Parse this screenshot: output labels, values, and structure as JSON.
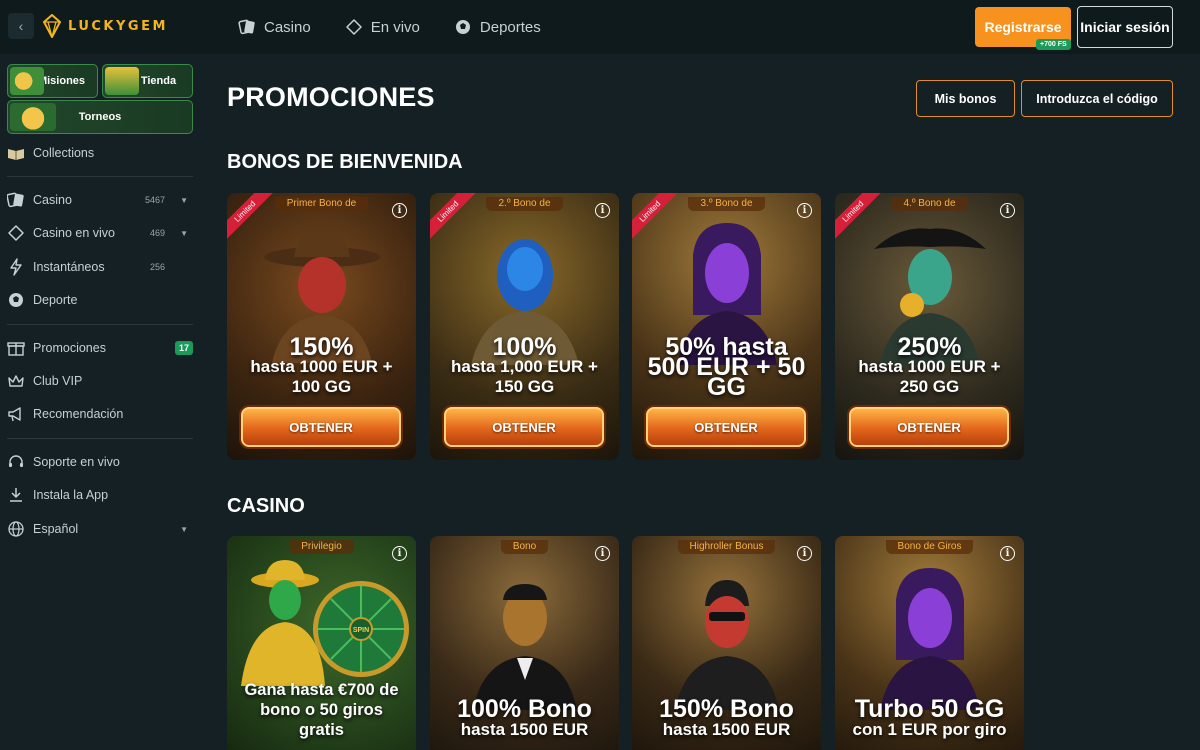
{
  "header": {
    "logo_text": "LUCKYGEM",
    "nav": [
      {
        "label": "Casino",
        "icon": "cards-icon"
      },
      {
        "label": "En vivo",
        "icon": "live-diamond-icon"
      },
      {
        "label": "Deportes",
        "icon": "soccer-ball-icon"
      }
    ],
    "register_label": "Registrarse",
    "register_badge": "+700 FS",
    "login_label": "Iniciar sesión",
    "colors": {
      "accent": "#f7921e",
      "brand": "#f2b51c",
      "success": "#1b9a5a"
    }
  },
  "sidebar": {
    "quick": {
      "missions": "Misiones",
      "shop": "Tienda",
      "tournaments": "Torneos"
    },
    "collections": "Collections",
    "casino": {
      "label": "Casino",
      "count": "5467"
    },
    "live_casino": {
      "label": "Casino en vivo",
      "count": "469"
    },
    "instant": {
      "label": "Instantáneos",
      "count": "256"
    },
    "sport": "Deporte",
    "promotions": {
      "label": "Promociones",
      "badge": "17"
    },
    "vip": "Club VIP",
    "referral": "Recomendación",
    "support": "Soporte en vivo",
    "install": "Instala la App",
    "language": "Español"
  },
  "main": {
    "title": "PROMOCIONES",
    "my_bonuses": "Mis bonos",
    "enter_code": "Introduzca el código",
    "welcome_title": "BONOS DE BIENVENIDA",
    "casino_title": "CASINO",
    "welcome_cards": [
      {
        "tag": "Primer Bono de",
        "limited": "Limited",
        "line1": "150%",
        "line2": "hasta 1000 EUR +",
        "line3": "100 GG",
        "button": "OBTENER"
      },
      {
        "tag": "2.º Bono de",
        "limited": "Limited",
        "line1": "100%",
        "line2": "hasta 1,000 EUR +",
        "line3": "150 GG",
        "button": "OBTENER"
      },
      {
        "tag": "3.º Bono de",
        "limited": "Limited",
        "line1": "50% hasta",
        "line2": "500 EUR + 50",
        "line3": "GG",
        "button": "OBTENER"
      },
      {
        "tag": "4.º Bono de",
        "limited": "Limited",
        "line1": "250%",
        "line2": "hasta 1000 EUR +",
        "line3": "250 GG",
        "button": "OBTENER"
      }
    ],
    "casino_cards": [
      {
        "tag": "Privilegio",
        "line1": "Gana hasta €700 de",
        "line2": "bono o 50 giros",
        "line3": "gratis"
      },
      {
        "tag": "Bono",
        "line1": "100% Bono",
        "line2": "hasta 1500 EUR"
      },
      {
        "tag": "Highroller Bonus",
        "line1": "150% Bono",
        "line2": "hasta 1500 EUR"
      },
      {
        "tag": "Bono de Giros",
        "line1": "Turbo 50 GG",
        "line2": "con 1 EUR por giro"
      }
    ],
    "wheel_labels": [
      "SPIN"
    ]
  }
}
